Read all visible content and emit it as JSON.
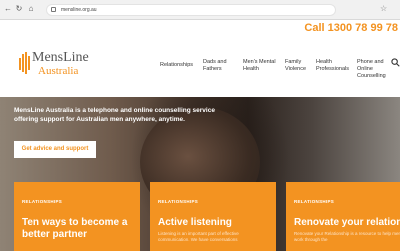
{
  "browser": {
    "url": "mensline.org.au"
  },
  "header": {
    "call": "Call 1300 78 99 78",
    "logo_line1": "MensLine",
    "logo_line2": "Australia",
    "nav": [
      {
        "label": "Relationships"
      },
      {
        "label": "Dads and Fathers"
      },
      {
        "label": "Men's Mental Health"
      },
      {
        "label": "Family Violence"
      },
      {
        "label": "Health Professionals"
      },
      {
        "label": "Phone and Online Counselling"
      }
    ]
  },
  "hero": {
    "text": "MensLine Australia is a telephone and online counselling service offering support for Australian men anywhere, anytime.",
    "cta": "Get advice and support"
  },
  "cards": [
    {
      "tag": "RELATIONSHIPS",
      "title": "Ten ways to become a better partner",
      "desc": ""
    },
    {
      "tag": "RELATIONSHIPS",
      "title": "Active listening",
      "desc": "Listening is an important part of effective communication. We have conversations"
    },
    {
      "tag": "RELATIONSHIPS",
      "title": "Renovate your relationship",
      "desc": "Renovate your Relationship is a resource to help men work through the"
    }
  ],
  "colors": {
    "accent": "#f39321"
  }
}
